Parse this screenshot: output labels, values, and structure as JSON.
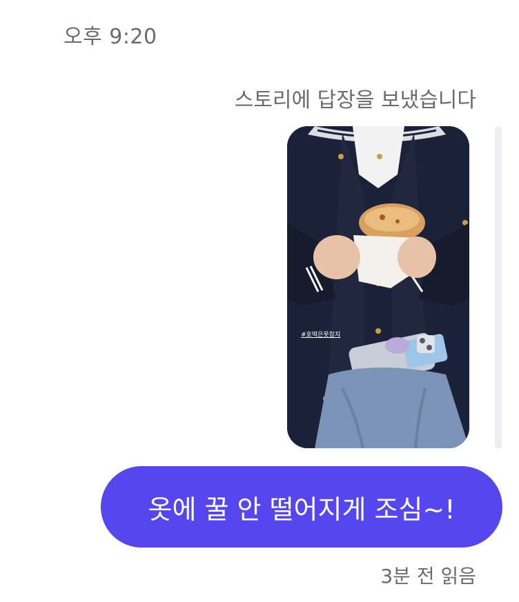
{
  "timestamp": "오후 9:20",
  "story_reply_label": "스토리에 답장을 보냈습니다",
  "story": {
    "hashtag": "#호떡은못참지"
  },
  "message": {
    "text": "옷에 꿀 안 떨어지게 조심~!"
  },
  "read_receipt": "3분 전 읽음",
  "colors": {
    "bubble": "#5546f0",
    "meta_text": "#6b6b6b",
    "scrollbar": "#eeeef2"
  }
}
